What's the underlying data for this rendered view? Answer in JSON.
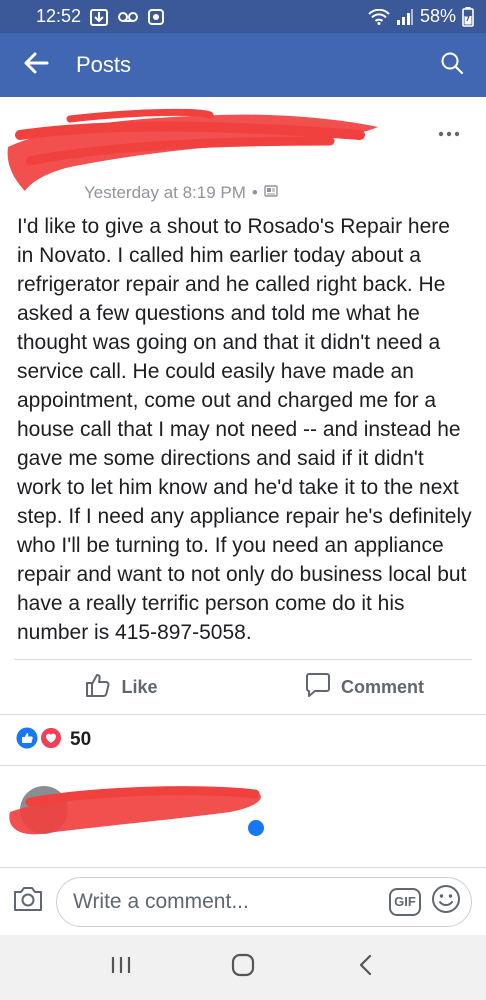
{
  "status": {
    "time": "12:52",
    "battery": "58%"
  },
  "appbar": {
    "title": "Posts"
  },
  "post": {
    "timestamp": "Yesterday at 8:19 PM",
    "separator": "•",
    "body": "I'd like to give a shout to Rosado's Repair here in Novato.  I called him earlier today about a refrigerator repair and he called right back.  He asked a few questions and told me what he thought was going on and that it didn't need a service call.  He could easily have made an appointment, come out and charged me for a house call that I may not need -- and instead he gave me some directions and said if it didn't work to let him know and he'd take it to the next step.  If I need any appliance repair he's definitely who I'll be turning to.  If you need an appliance repair and want to not only do business local but have a really terrific person come do it his number is 415-897-5058."
  },
  "actions": {
    "like": "Like",
    "comment": "Comment"
  },
  "reactions": {
    "count": "50"
  },
  "compose": {
    "placeholder": "Write a comment...",
    "gif": "GIF"
  },
  "colors": {
    "brand": "#4267b2",
    "statusbar": "#3b5998",
    "like_blue": "#1877f2",
    "love_red": "#f33e58",
    "redaction": "#f0413f"
  },
  "icons": [
    "back-arrow-icon",
    "search-icon",
    "more-icon",
    "globe-icon",
    "like-icon",
    "comment-icon",
    "camera-icon",
    "emoji-icon",
    "recents-icon",
    "home-icon",
    "back-icon"
  ]
}
